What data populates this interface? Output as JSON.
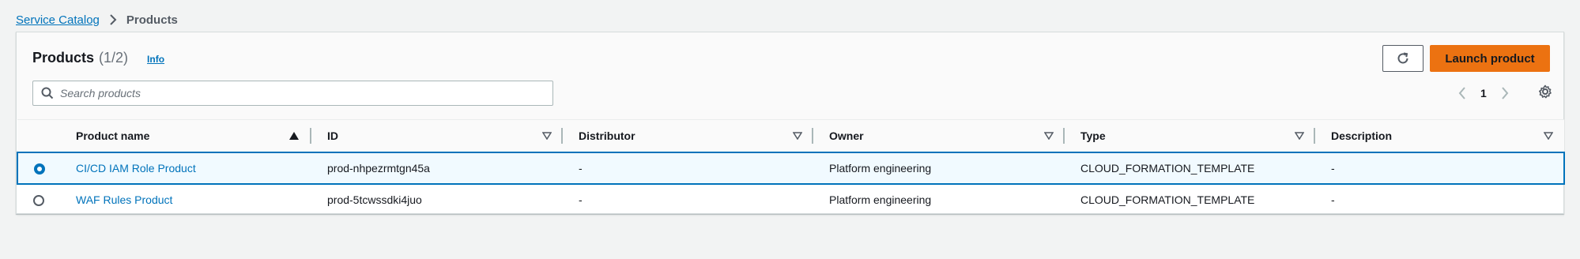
{
  "breadcrumb": {
    "parent": "Service Catalog",
    "current": "Products"
  },
  "panel": {
    "title": "Products",
    "count": "(1/2)",
    "info_label": "Info",
    "launch_label": "Launch product",
    "refresh_icon": "refresh-icon"
  },
  "search": {
    "placeholder": "Search products",
    "value": ""
  },
  "pagination": {
    "page": "1",
    "prev_icon": "chevron-left-icon",
    "next_icon": "chevron-right-icon",
    "settings_icon": "gear-icon"
  },
  "table": {
    "columns": [
      "Product name",
      "ID",
      "Distributor",
      "Owner",
      "Type",
      "Description"
    ],
    "sort": {
      "column": "Product name",
      "direction": "ascending"
    },
    "rows": [
      {
        "selected": true,
        "name": "CI/CD IAM Role Product",
        "id": "prod-nhpezrmtgn45a",
        "distributor": "-",
        "owner": "Platform engineering",
        "type": "CLOUD_FORMATION_TEMPLATE",
        "description": "-"
      },
      {
        "selected": false,
        "name": "WAF Rules Product",
        "id": "prod-5tcwssdki4juo",
        "distributor": "-",
        "owner": "Platform engineering",
        "type": "CLOUD_FORMATION_TEMPLATE",
        "description": "-"
      }
    ]
  },
  "colors": {
    "accent": "#0073bb",
    "primary_button": "#ec7211",
    "selected_row_bg": "#f1faff"
  }
}
